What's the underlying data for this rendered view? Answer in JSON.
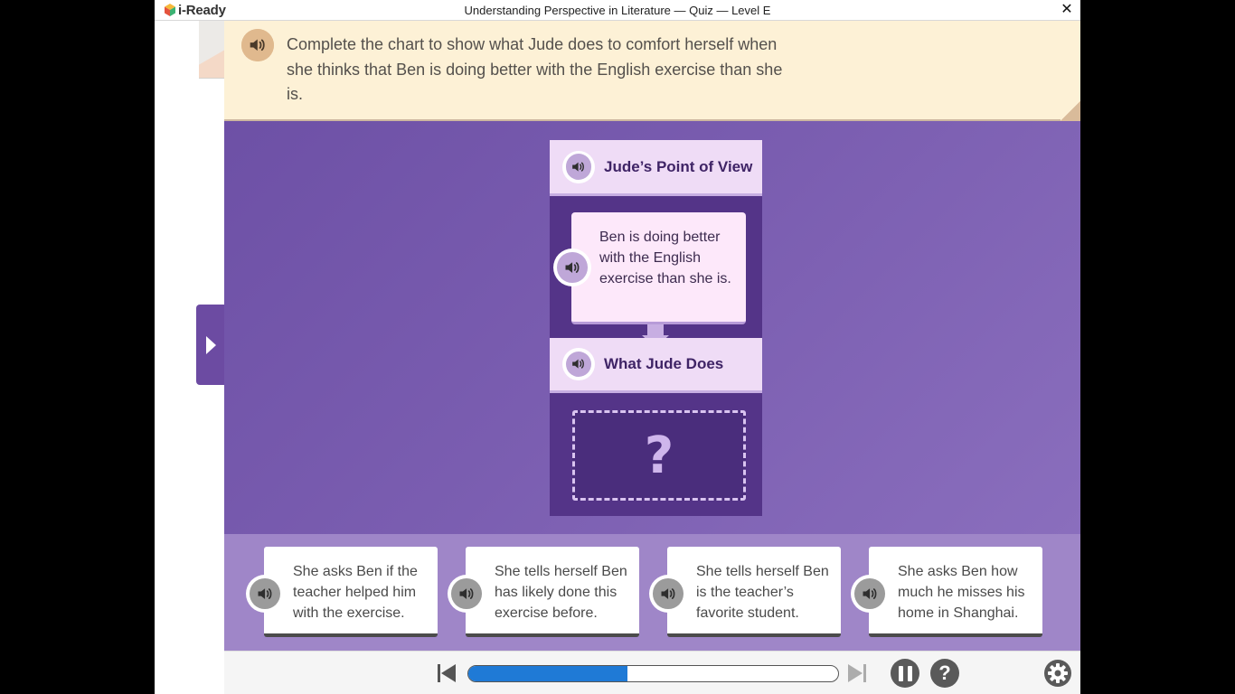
{
  "window": {
    "brand": "i-Ready",
    "title": "Understanding Perspective in Literature — Quiz — Level E",
    "close_glyph": "✕"
  },
  "prompt": {
    "text": "Complete the chart to show what Jude does to comfort herself when she thinks that Ben is doing better with the English exercise than she is.",
    "audio_icon": "speaker-icon"
  },
  "chart": {
    "pov_header": "Jude’s Point of View",
    "pov_text": "Ben is doing better with the English exercise than she is.",
    "what_header": "What Jude Does",
    "drop_placeholder": "?"
  },
  "answers": [
    {
      "text": "She asks Ben if the teacher helped him with the exercise."
    },
    {
      "text": "She tells herself Ben has likely done this exercise before."
    },
    {
      "text": "She tells herself Ben is the teacher’s favorite student."
    },
    {
      "text": "She asks Ben how much he misses his home in Shanghai."
    }
  ],
  "bottombar": {
    "progress_fraction": 0.43,
    "help_glyph": "?"
  },
  "colors": {
    "stage": "#7a5db0",
    "prompt_bg": "#fdf1d6",
    "chart_bg": "#543488",
    "header_bg": "#efdcf6",
    "tray_bg": "#9f86c8",
    "progress": "#1f7ad6"
  }
}
